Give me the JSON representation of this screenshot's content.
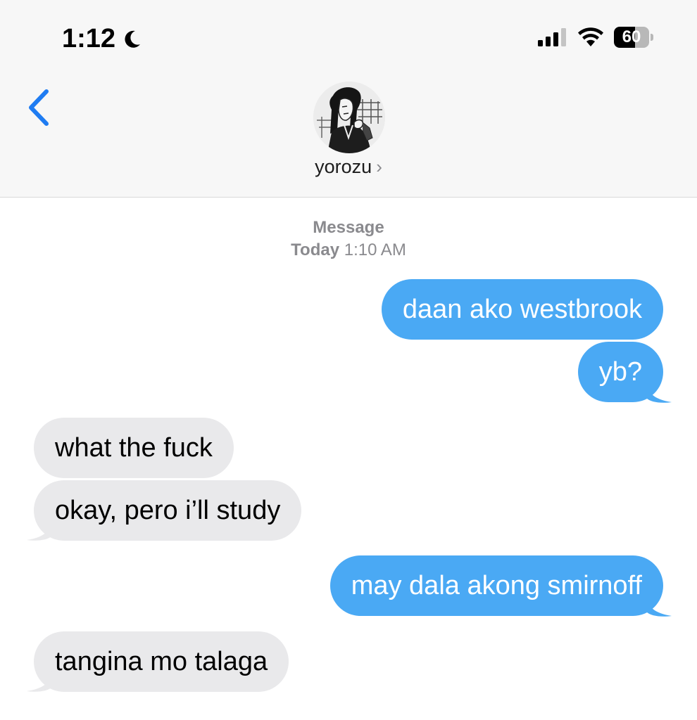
{
  "status_bar": {
    "time": "1:12",
    "battery": "60",
    "battery_level": 0.6
  },
  "header": {
    "contact_name": "yorozu",
    "chevron": "›"
  },
  "thread": {
    "service_label": "Message",
    "date_label": "Today",
    "time_label": "1:10 AM",
    "messages": [
      {
        "direction": "sent",
        "text": "daan ako westbrook"
      },
      {
        "direction": "sent",
        "text": "yb?"
      },
      {
        "direction": "received",
        "text": "what the fuck"
      },
      {
        "direction": "received",
        "text": "okay, pero i’ll study"
      },
      {
        "direction": "sent",
        "text": "may dala akong smirnoff"
      },
      {
        "direction": "received",
        "text": "tangina mo talaga"
      }
    ]
  },
  "icons": {
    "moon": "moon-icon",
    "signal": "cellular-signal-icon",
    "wifi": "wifi-icon",
    "battery": "battery-icon",
    "back": "chevron-left-icon",
    "avatar": "contact-avatar"
  },
  "colors": {
    "sent_bubble": "#4aa9f4",
    "received_bubble": "#e9e9eb",
    "accent": "#1f7cf2",
    "secondary_text": "#8a8a8e"
  }
}
